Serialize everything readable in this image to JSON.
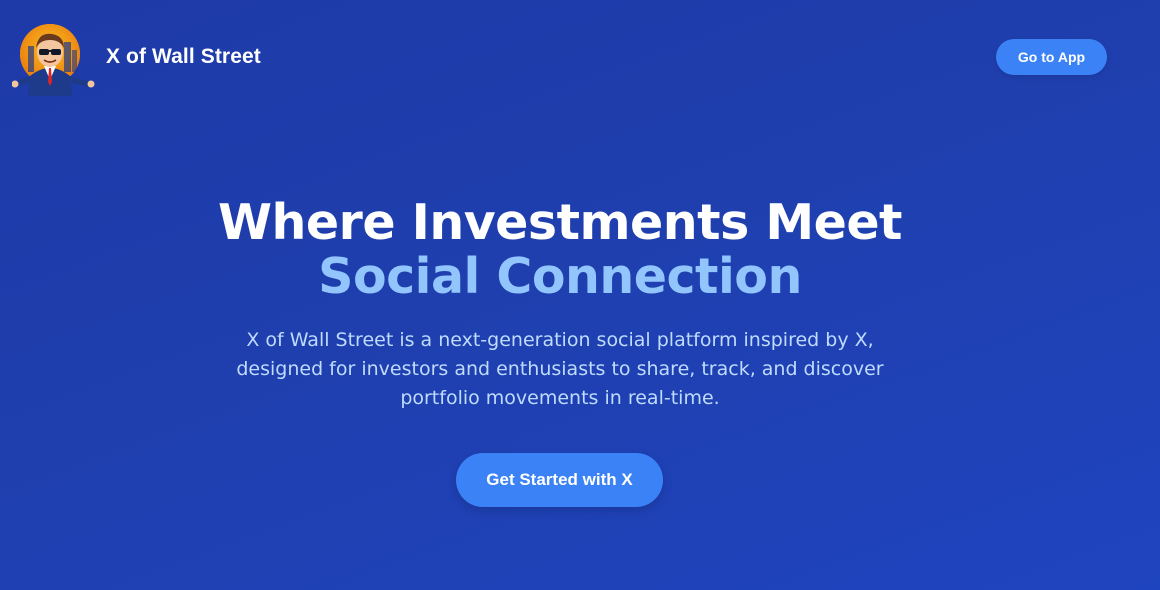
{
  "header": {
    "brand_name": "X of Wall Street",
    "logo_icon": "wall-street-mascot-icon",
    "go_to_app_label": "Go to App"
  },
  "hero": {
    "headline_line1": "Where Investments Meet",
    "headline_line2": "Social Connection",
    "description": "X of Wall Street is a next-generation social platform inspired by X, designed for investors and enthusiasts to share, track, and discover portfolio movements in real-time.",
    "cta_label": "Get Started with X"
  },
  "colors": {
    "background_start": "#1e3aa8",
    "background_end": "#1f44bf",
    "accent_button": "#3b82f6",
    "headline_highlight": "#93c5fd",
    "body_text": "#bfdbfe"
  }
}
